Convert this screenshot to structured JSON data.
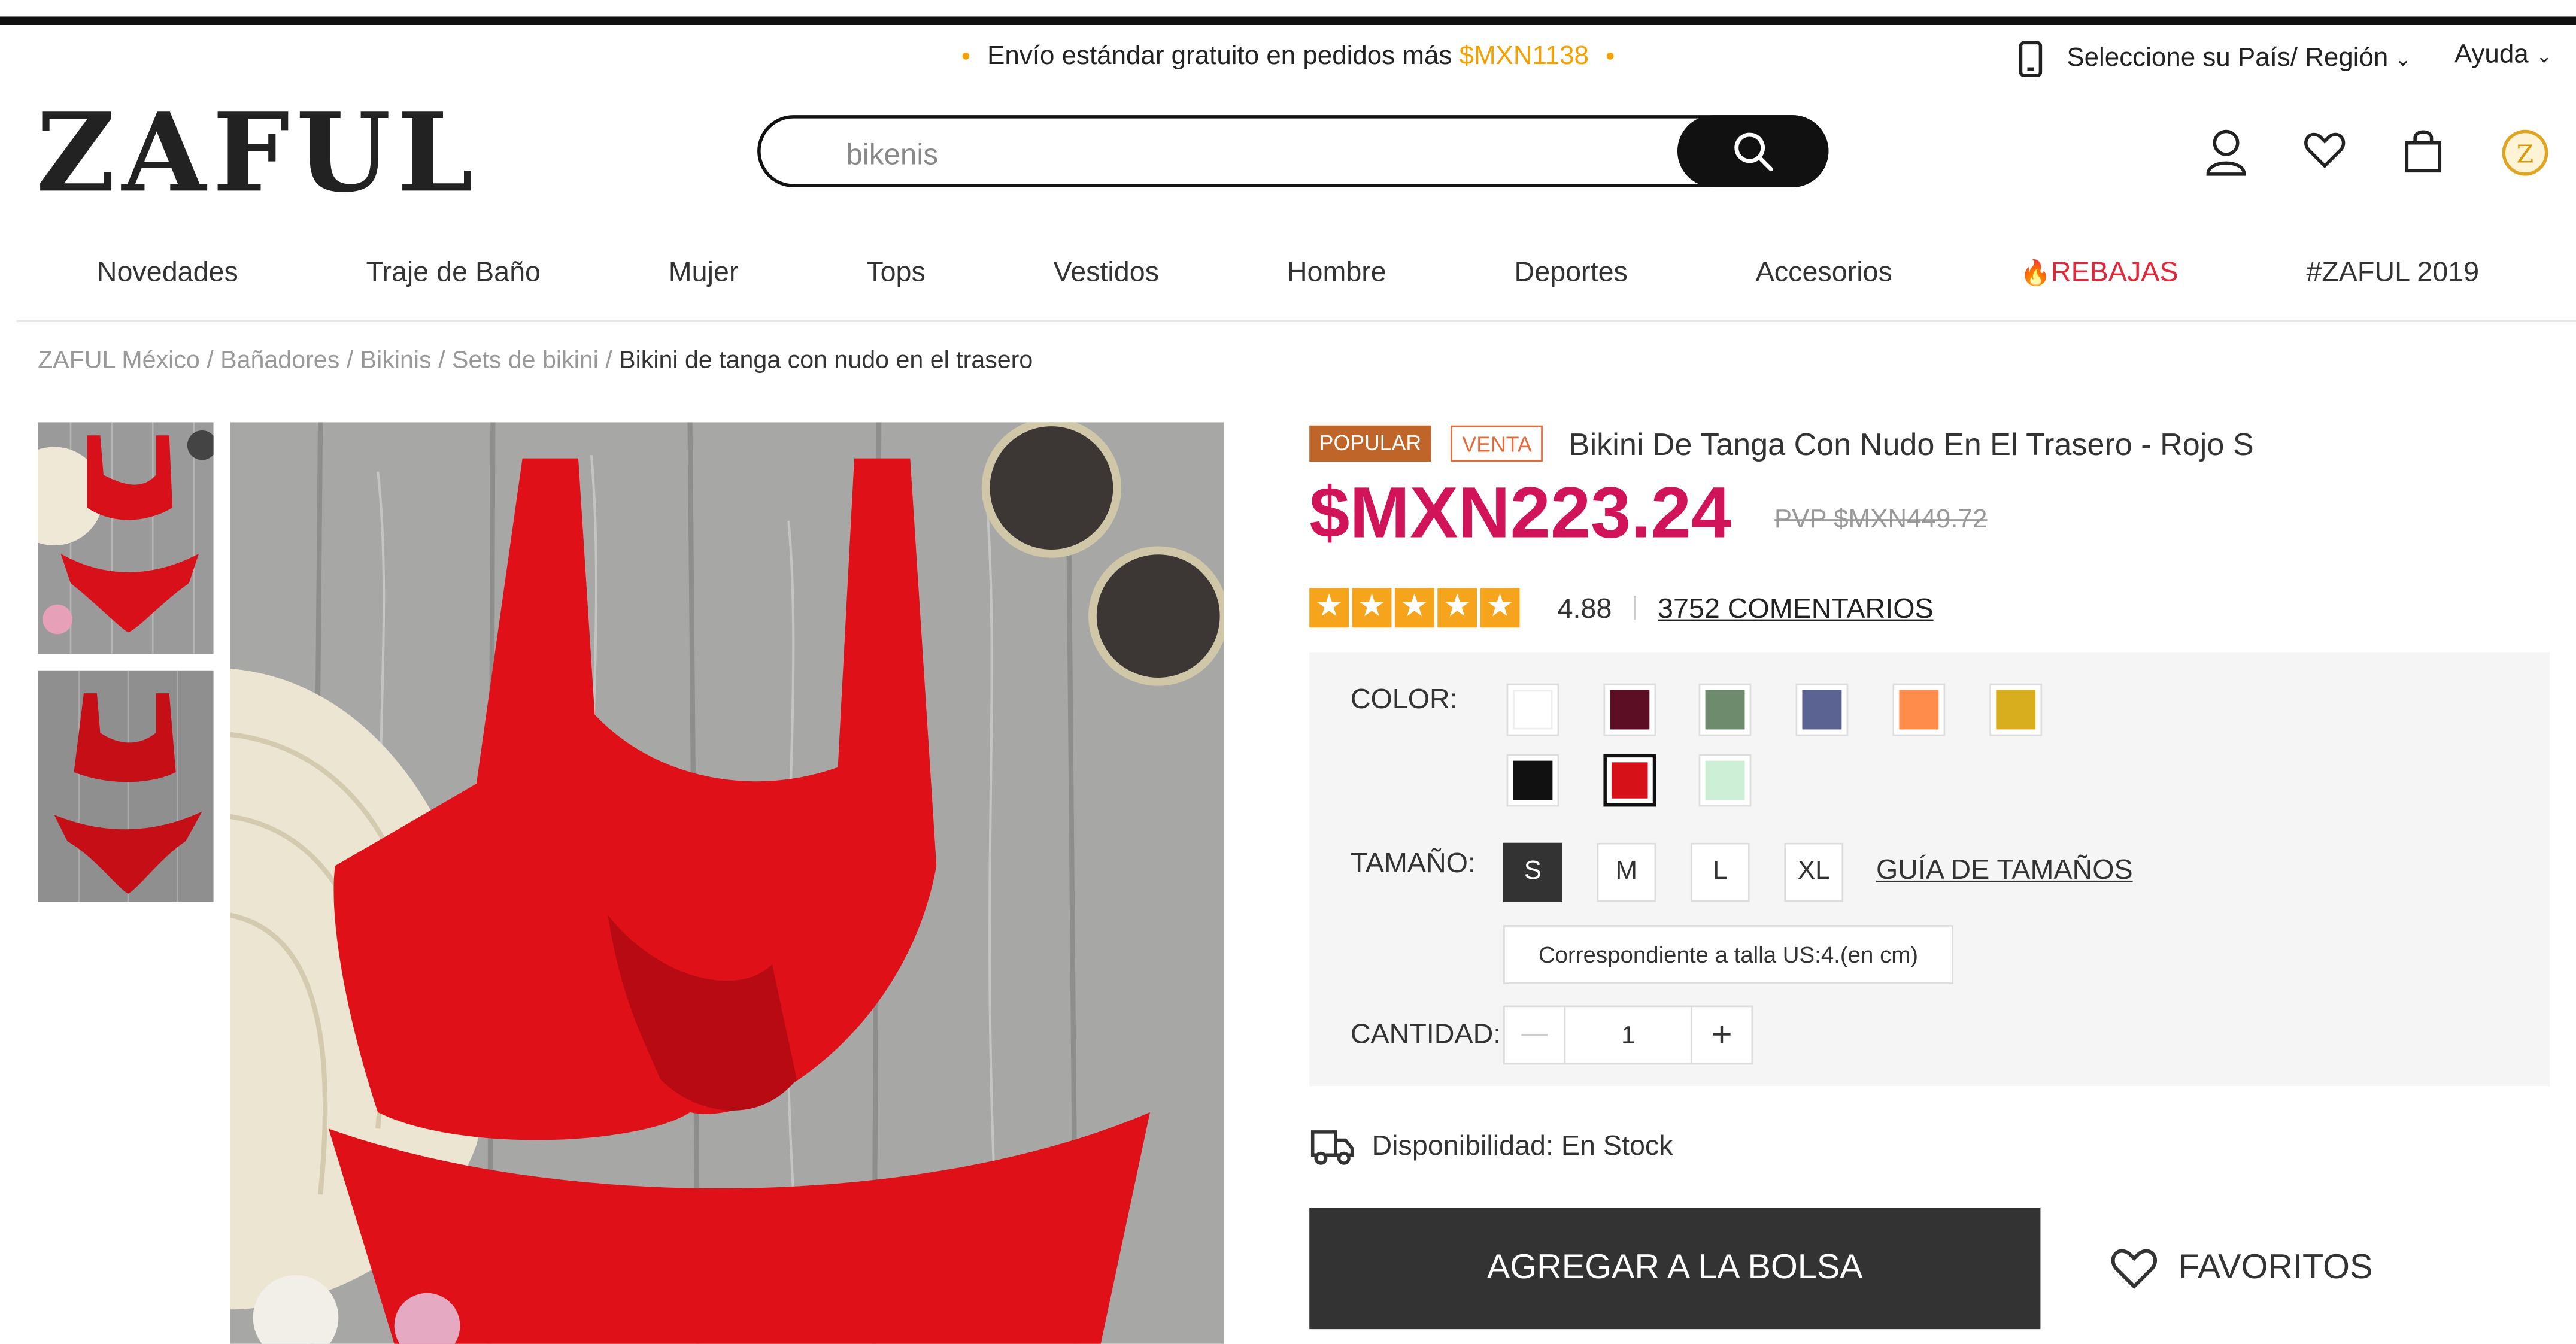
{
  "header": {
    "promo_text": "Envío estándar gratuito en pedidos más ",
    "promo_amount": "$MXN1138",
    "region_label": "Seleccione su País/ Región",
    "help_label": "Ayuda",
    "logo_text": "ZAFUL",
    "search_value": "bikenis"
  },
  "nav": {
    "items": [
      "Novedades",
      "Traje de Baño",
      "Mujer",
      "Tops",
      "Vestidos",
      "Hombre",
      "Deportes",
      "Accesorios",
      "REBAJAS",
      "#ZAFUL 2019"
    ]
  },
  "breadcrumb": {
    "items": [
      "ZAFUL México",
      "Bañadores",
      "Bikinis",
      "Sets de bikini"
    ],
    "current": "Bikini de tanga con nudo en el trasero"
  },
  "product": {
    "tag_popular": "POPULAR",
    "tag_sale": "VENTA",
    "title": "Bikini De Tanga Con Nudo En El Trasero - Rojo S",
    "price": "$MXN223.24",
    "old_price": "PVP $MXN449.72",
    "rating": "4.88",
    "reviews": "3752 COMENTARIOS"
  },
  "options": {
    "color_label": "COLOR:",
    "colors": [
      "#ffffff",
      "#5c0f24",
      "#6e8b6e",
      "#5a6391",
      "#ff8c4a",
      "#d9ae1e",
      "#111111",
      "#d61117",
      "#ccefd6"
    ],
    "selected_color": "#d61117",
    "size_label": "TAMAÑO:",
    "sizes": [
      "S",
      "M",
      "L",
      "XL"
    ],
    "selected_size": "S",
    "size_guide": "GUÍA DE TAMAÑOS",
    "size_note": "Correspondiente a talla US:4.(en cm)",
    "qty_label": "CANTIDAD:",
    "qty_value": "1",
    "qty_minus": "—",
    "qty_plus": "+"
  },
  "availability": "Disponibilidad: En Stock",
  "actions": {
    "add_to_bag": "AGREGAR A LA BOLSA",
    "favorites": "FAVORITOS"
  }
}
